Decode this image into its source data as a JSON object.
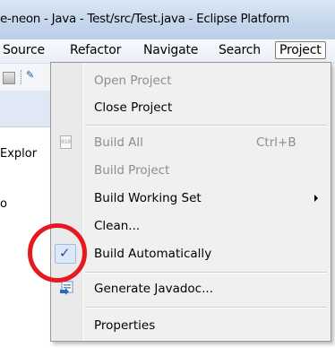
{
  "window": {
    "title": "e-neon - Java - Test/src/Test.java - Eclipse Platform"
  },
  "menubar": {
    "items": [
      "Source",
      "Refactor",
      "Navigate",
      "Search",
      "Project"
    ],
    "active": "Project"
  },
  "background": {
    "explorer_label": "Explor",
    "fragment_label": "o"
  },
  "project_menu": {
    "open_project": "Open Project",
    "close_project": "Close Project",
    "build_all": "Build All",
    "build_all_shortcut": "Ctrl+B",
    "build_project": "Build Project",
    "build_working_set": "Build Working Set",
    "clean": "Clean...",
    "build_automatically": "Build Automatically",
    "build_automatically_checked": true,
    "check_glyph": "✓",
    "generate_javadoc": "Generate Javadoc...",
    "properties": "Properties",
    "build_all_icon_text": "010"
  },
  "icons": {
    "build_all": "binary-file-icon",
    "build_automatically": "checkmark-icon",
    "generate_javadoc": "javadoc-icon",
    "submenu": "chevron-right-icon"
  },
  "colors": {
    "annotation_circle": "#e5191f",
    "check": "#1d4f9c",
    "disabled_text": "#8d8d8d"
  }
}
